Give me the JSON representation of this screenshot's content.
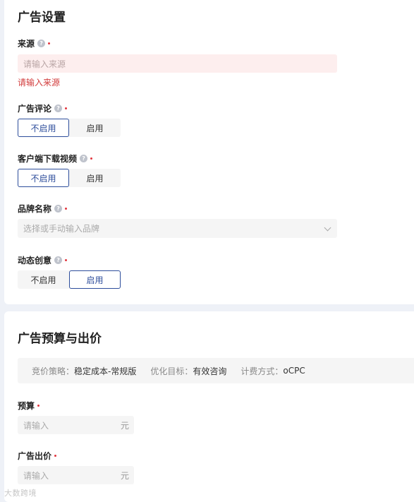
{
  "ad_settings": {
    "title": "广告设置",
    "source": {
      "label": "来源",
      "placeholder": "请输入来源",
      "error": "请输入来源"
    },
    "ad_comment": {
      "label": "广告评论",
      "options": [
        "不启用",
        "启用"
      ],
      "selected": 0
    },
    "client_download_video": {
      "label": "客户端下载视频",
      "options": [
        "不启用",
        "启用"
      ],
      "selected": 0
    },
    "brand_name": {
      "label": "品牌名称",
      "placeholder": "选择或手动输入品牌"
    },
    "dynamic_creative": {
      "label": "动态创意",
      "options": [
        "不启用",
        "启用"
      ],
      "selected": 1
    }
  },
  "budget_bid": {
    "title": "广告预算与出价",
    "info": {
      "strategy_key": "竞价策略：",
      "strategy_val": "稳定成本-常规版",
      "goal_key": "优化目标：",
      "goal_val": "有效咨询",
      "billing_key": "计费方式：",
      "billing_val": "oCPC"
    },
    "budget": {
      "label": "预算",
      "placeholder": "请输入",
      "unit": "元"
    },
    "bid": {
      "label": "广告出价",
      "placeholder": "请输入",
      "unit": "元"
    }
  },
  "watermark": "大数跨境",
  "icons": {
    "help": "question-circle-icon",
    "chevron": "chevron-down-icon"
  },
  "colors": {
    "accent": "#2d4d9b",
    "error": "#d23c3c",
    "required": "#e2363f"
  }
}
